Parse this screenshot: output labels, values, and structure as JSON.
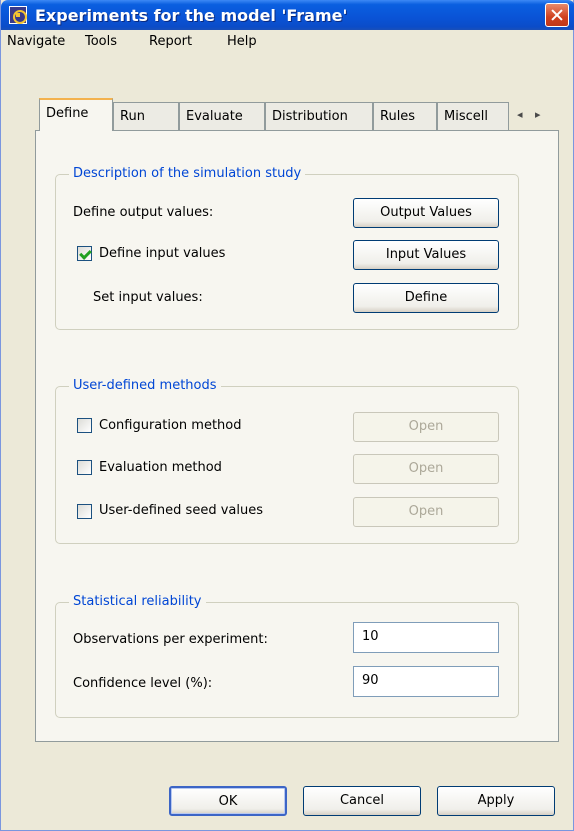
{
  "window": {
    "title": "Experiments for the model 'Frame'"
  },
  "menu": [
    "Navigate",
    "Tools",
    "Report",
    "Help"
  ],
  "tabs": [
    "Define",
    "Run",
    "Evaluate",
    "Distribution",
    "Rules",
    "Miscell"
  ],
  "tab_scroll": {
    "left": "◂",
    "right": "▸"
  },
  "description_group": {
    "title": "Description of the simulation study",
    "output_label": "Define output values:",
    "output_button": "Output Values",
    "input_checkbox_label": "Define input values",
    "input_checkbox_checked": true,
    "input_button": "Input Values",
    "set_input_label": "Set input values:",
    "define_button": "Define"
  },
  "methods_group": {
    "title": "User-defined methods",
    "items": [
      {
        "label": "Configuration method",
        "checked": false,
        "button": "Open"
      },
      {
        "label": "Evaluation method",
        "checked": false,
        "button": "Open"
      },
      {
        "label": "User-defined seed values",
        "checked": false,
        "button": "Open"
      }
    ]
  },
  "reliability_group": {
    "title": "Statistical reliability",
    "observations_label": "Observations per experiment:",
    "observations_value": "10",
    "confidence_label": "Confidence level (%):",
    "confidence_value": "90"
  },
  "footer": {
    "ok": "OK",
    "cancel": "Cancel",
    "apply": "Apply"
  }
}
